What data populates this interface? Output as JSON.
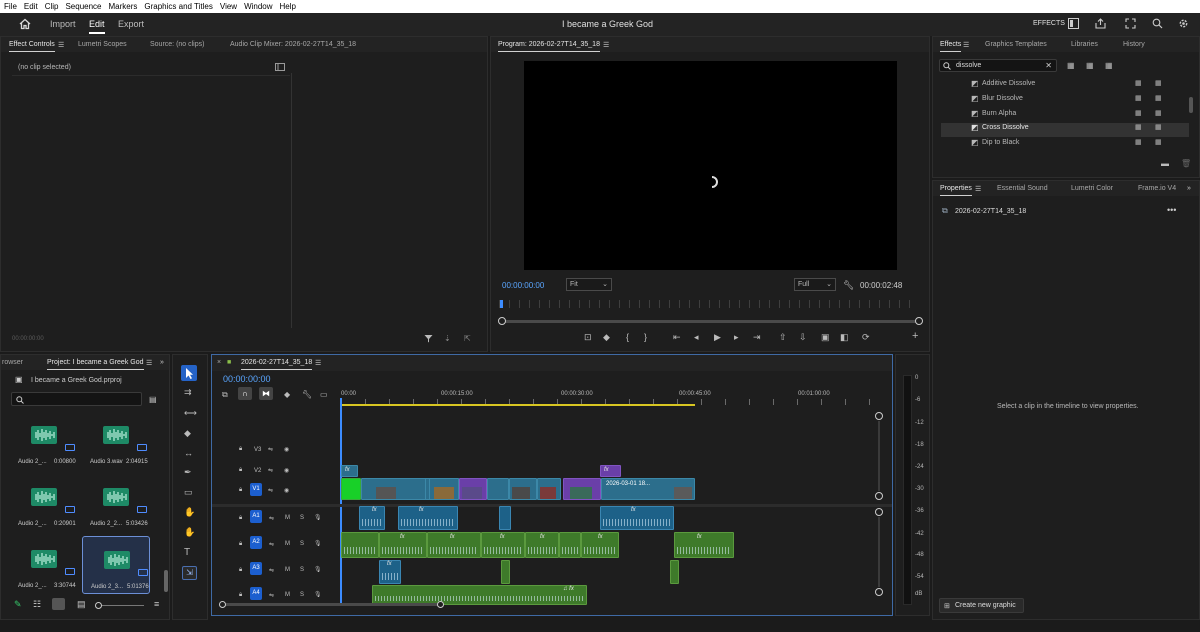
{
  "menu": [
    "File",
    "Edit",
    "Clip",
    "Sequence",
    "Markers",
    "Graphics and Titles",
    "View",
    "Window",
    "Help"
  ],
  "header": {
    "tabs": [
      "Import",
      "Edit",
      "Export"
    ],
    "active_tab": "Edit",
    "project_title": "I became a Greek God",
    "effects_label": "EFFECTS"
  },
  "effect_controls": {
    "tabs": [
      "Effect Controls",
      "Lumetri Scopes",
      "Source: (no clips)",
      "Audio Clip Mixer: 2026-02-27T14_35_18"
    ],
    "no_clip": "(no clip selected)",
    "timecode": "00:00:00:00"
  },
  "program": {
    "title": "Program: 2026-02-27T14_35_18",
    "timecode": "00:00:00:00",
    "fit": "Fit",
    "quality": "Full",
    "duration": "00:00:02:48"
  },
  "effects_panel": {
    "tabs": [
      "Effects",
      "Graphics Templates",
      "Libraries",
      "History"
    ],
    "search_value": "dissolve",
    "items": [
      "Additive Dissolve",
      "Blur Dissolve",
      "Burn Alpha",
      "Cross Dissolve",
      "Dip to Black"
    ],
    "selected": "Cross Dissolve"
  },
  "properties": {
    "tabs": [
      "Properties",
      "Essential Sound",
      "Lumetri Color",
      "Frame.io V4"
    ],
    "sequence": "2026-02-27T14_35_18",
    "hint": "Select a clip in the timeline to view properties.",
    "create_graphic": "Create new graphic"
  },
  "project": {
    "tabs": [
      "rowser",
      "Project: I became a Greek God"
    ],
    "file": "I became a Greek God.prproj",
    "items": [
      {
        "name": "Audio 2_...",
        "duration": "0:00800"
      },
      {
        "name": "Audio 3.wav",
        "duration": "2:04915"
      },
      {
        "name": "Audio 2_...",
        "duration": "0:20901"
      },
      {
        "name": "Audio 2_2...",
        "duration": "5:03426"
      },
      {
        "name": "Audio 2_...",
        "duration": "3:30744"
      },
      {
        "name": "Audio 2_3...",
        "duration": "5:01376"
      }
    ]
  },
  "timeline": {
    "sequence_tab": "2026-02-27T14_35_18",
    "timecode": "00:00:00:00",
    "ruler": [
      "00:00",
      "00:00:15:00",
      "00:00:30:00",
      "00:00:45:00",
      "00:01:00:00"
    ],
    "video_tracks": [
      "V3",
      "V2",
      "V1"
    ],
    "audio_tracks": [
      "A1",
      "A2",
      "A3",
      "A4"
    ],
    "clip_label": "2026-03-01 18...",
    "ms": [
      "M",
      "S"
    ]
  },
  "meter": {
    "scale": [
      "0",
      "-6",
      "-12",
      "-18",
      "-24",
      "-30",
      "-36",
      "-42",
      "-48",
      "-54"
    ],
    "unit": "dB"
  }
}
